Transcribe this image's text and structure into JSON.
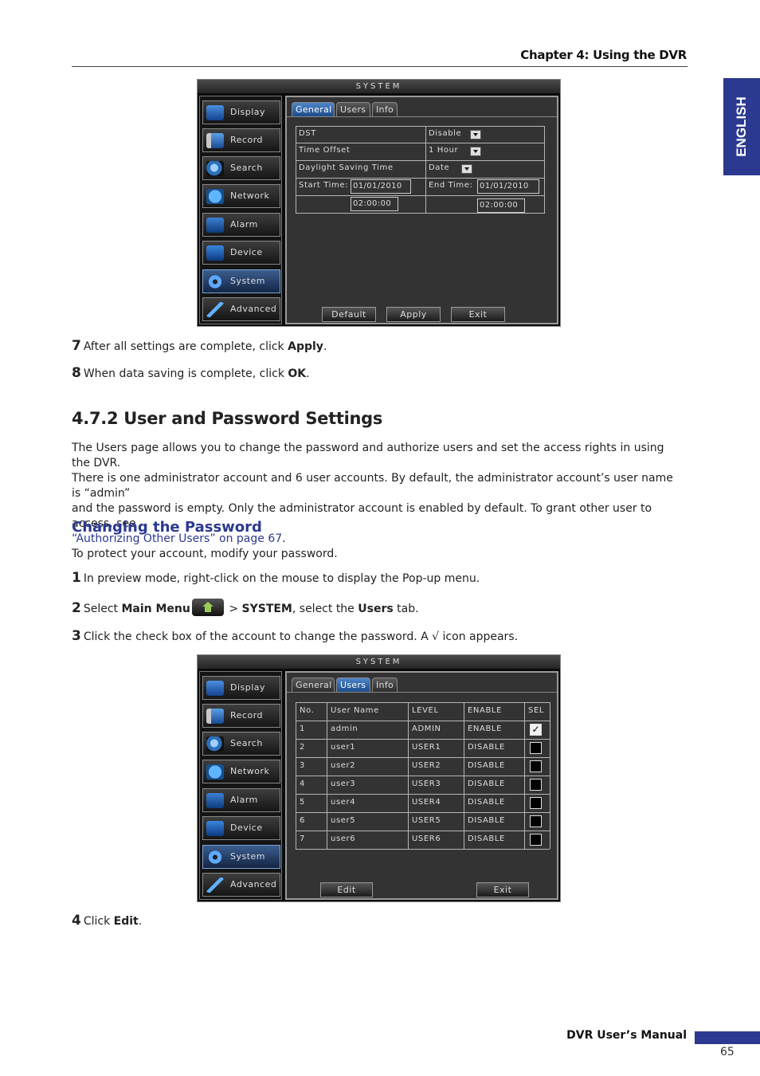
{
  "header": {
    "chapter": "Chapter 4: Using the DVR",
    "side_tab": "ENGLISH"
  },
  "dvr_general": {
    "title": "SYSTEM",
    "nav": [
      "Display",
      "Record",
      "Search",
      "Network",
      "Alarm",
      "Device",
      "System",
      "Advanced"
    ],
    "active_nav": "System",
    "tabs": [
      "General",
      "Users",
      "Info"
    ],
    "active_tab": "General",
    "rows": {
      "dst_label": "DST",
      "dst_value": "Disable",
      "offset_label": "Time Offset",
      "offset_value": "1 Hour",
      "saving_label": "Daylight Saving Time",
      "saving_value": "Date",
      "start_label": "Start Time:",
      "start_date": "01/01/2010",
      "start_time": "02:00:00",
      "end_label": "End Time:",
      "end_date": "01/01/2010",
      "end_time": "02:00:00"
    },
    "buttons": {
      "default": "Default",
      "apply": "Apply",
      "exit": "Exit"
    }
  },
  "steps_a": {
    "s7": {
      "num": "7",
      "pre": "After all settings are complete, click ",
      "bold": "Apply",
      "post": "."
    },
    "s8": {
      "num": "8",
      "pre": "When data saving is complete, click ",
      "bold": "OK",
      "post": "."
    }
  },
  "section": {
    "heading": "4.7.2 User and Password Settings",
    "para_l1": "The Users page allows you to change the password and authorize users and set the access rights in using the DVR.",
    "para_l2": "There is one administrator account and 6 user accounts. By default, the administrator account’s user name is “admin”",
    "para_l3": "and the password is empty. Only the administrator account is enabled by default. To grant other user to access, see",
    "para_link": "“Authorizing Other Users” on page 67",
    "para_end": "."
  },
  "subsection": {
    "heading": "Changing the Password",
    "intro": "To protect your account, modify your password."
  },
  "steps_b": {
    "s1": {
      "num": "1",
      "text": "In preview mode, right-click on the mouse to display the Pop-up menu."
    },
    "s2": {
      "num": "2",
      "pre": "Select ",
      "bold1": "Main Menu",
      "mid1": " > ",
      "bold2": "SYSTEM",
      "mid2": ", select the ",
      "bold3": "Users",
      "post": " tab."
    },
    "s3": {
      "num": "3",
      "text": "Click the check box of the account to change the password. A √ icon appears."
    },
    "s4": {
      "num": "4",
      "pre": "Click ",
      "bold": "Edit",
      "post": "."
    }
  },
  "dvr_users": {
    "title": "SYSTEM",
    "nav": [
      "Display",
      "Record",
      "Search",
      "Network",
      "Alarm",
      "Device",
      "System",
      "Advanced"
    ],
    "tabs": [
      "General",
      "Users",
      "Info"
    ],
    "active_tab": "Users",
    "columns": [
      "No.",
      "User Name",
      "LEVEL",
      "ENABLE",
      "SEL"
    ],
    "rows": [
      {
        "no": "1",
        "name": "admin",
        "level": "ADMIN",
        "enable": "ENABLE",
        "sel": true
      },
      {
        "no": "2",
        "name": "user1",
        "level": "USER1",
        "enable": "DISABLE",
        "sel": false
      },
      {
        "no": "3",
        "name": "user2",
        "level": "USER2",
        "enable": "DISABLE",
        "sel": false
      },
      {
        "no": "4",
        "name": "user3",
        "level": "USER3",
        "enable": "DISABLE",
        "sel": false
      },
      {
        "no": "5",
        "name": "user4",
        "level": "USER4",
        "enable": "DISABLE",
        "sel": false
      },
      {
        "no": "6",
        "name": "user5",
        "level": "USER5",
        "enable": "DISABLE",
        "sel": false
      },
      {
        "no": "7",
        "name": "user6",
        "level": "USER6",
        "enable": "DISABLE",
        "sel": false
      }
    ],
    "check_mark": "✓",
    "buttons": {
      "edit": "Edit",
      "exit": "Exit"
    }
  },
  "footer": {
    "manual": "DVR User’s Manual",
    "page": "65"
  },
  "colors": {
    "accent": "#2b3990",
    "dvr_bg": "#333333",
    "tab_active": "#2d5fa3"
  }
}
